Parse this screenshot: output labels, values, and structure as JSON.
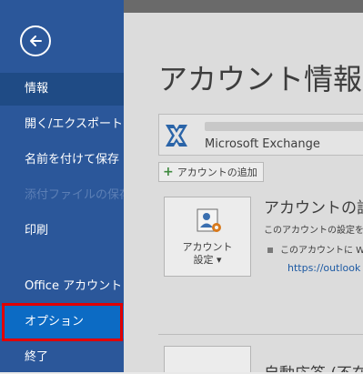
{
  "sidebar": {
    "items": [
      {
        "label": "情報"
      },
      {
        "label": "開く/エクスポート"
      },
      {
        "label": "名前を付けて保存"
      },
      {
        "label": "添付ファイルの保存"
      },
      {
        "label": "印刷"
      },
      {
        "label": "Office アカウント"
      },
      {
        "label": "オプション"
      },
      {
        "label": "終了"
      }
    ]
  },
  "main": {
    "title": "アカウント情報",
    "account_type": "Microsoft Exchange",
    "add_account_label": "アカウントの追加",
    "settings_button": {
      "line1": "アカウント",
      "line2": "設定 ▾"
    },
    "section_title": "アカウントの設定",
    "section_desc": "このアカウントの設定を変",
    "bullet_text": "このアカウントに W",
    "link_text": "https://outlook",
    "bottom_title": "自動応答 (不在"
  },
  "colors": {
    "sidebar_bg": "#2b579a",
    "options_highlight": "#0c6bc4",
    "callout_border": "#e00000"
  }
}
